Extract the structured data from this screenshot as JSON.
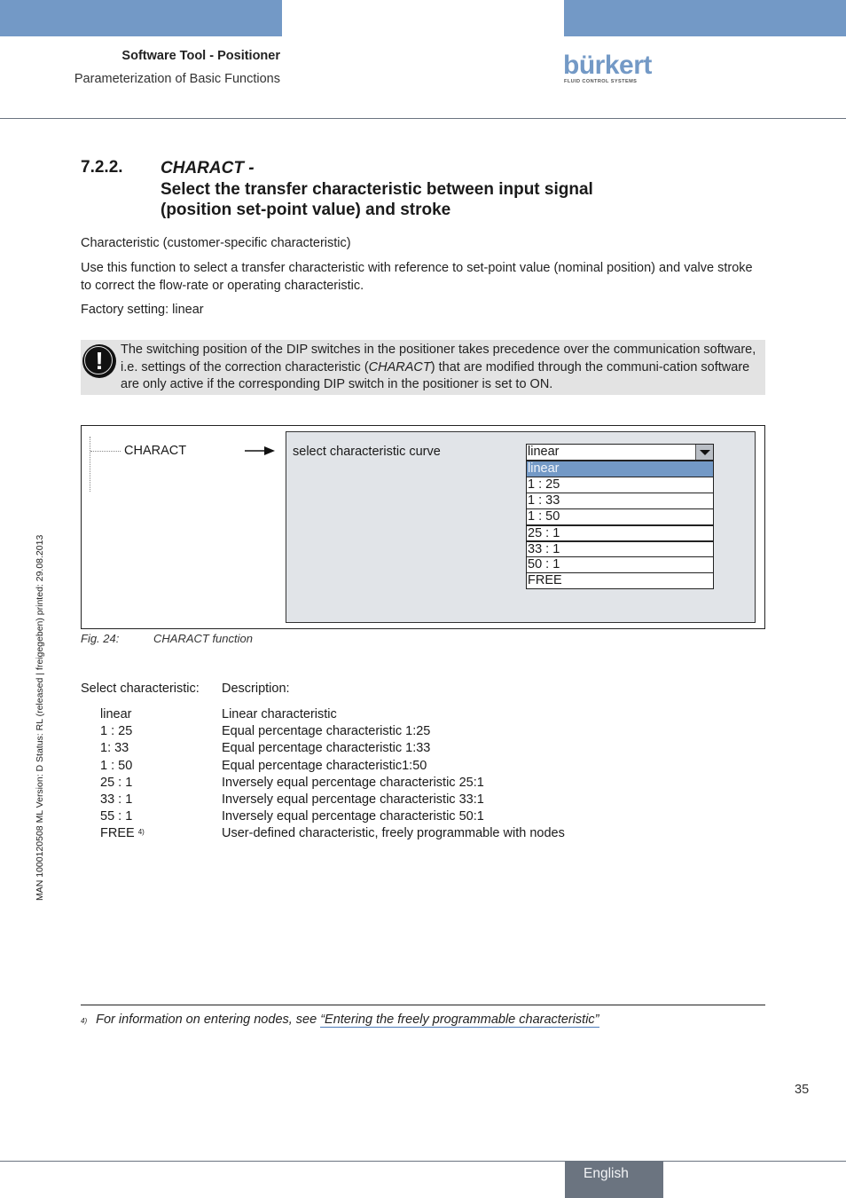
{
  "header": {
    "title": "Software Tool - Positioner",
    "subtitle": "Parameterization of Basic Functions",
    "logo": {
      "word": "bürkert",
      "tagline": "FLUID CONTROL SYSTEMS"
    },
    "accent_color": "#7399c6"
  },
  "section": {
    "number": "7.2.2.",
    "title_italic": "CHARACT -",
    "title_line2": "Select the transfer characteristic between input signal",
    "title_line3": "(position set-point value) and stroke"
  },
  "paragraphs": [
    "Characteristic (customer-specific characteristic)",
    "Use this function to select a transfer characteristic with reference to set-point value (nominal position) and valve stroke to correct the flow-rate or operating characteristic.",
    "Factory setting: linear"
  ],
  "note": {
    "icon": "exclamation-icon",
    "text_before": "The switching position of the DIP switches in the positioner takes precedence over the communication software, i.e. settings of the correction characteristic (",
    "text_italic": "CHARACT",
    "text_after": ") that are modified through the communi-cation software are only active if the corresponding DIP switch in the positioner is set to ON."
  },
  "figure": {
    "tree_item": "CHARACT",
    "panel_label": "select characteristic curve",
    "dropdown": {
      "selected": "linear",
      "options": [
        "linear",
        "1 : 25",
        "1 : 33",
        "1 : 50",
        "25 : 1",
        "33 : 1",
        "50 : 1",
        "FREE"
      ],
      "highlighted": "linear",
      "highlight_color": "#7399c6"
    },
    "caption_label": "Fig. 24:",
    "caption_text": "CHARACT function"
  },
  "table": {
    "col1_header": "Select characteristic:",
    "col2_header": "Description:",
    "rows": [
      {
        "key": "linear",
        "desc": "Linear characteristic"
      },
      {
        "key": "1 : 25",
        "desc": "Equal percentage characteristic 1:25"
      },
      {
        "key": "1: 33",
        "desc": "Equal percentage characteristic 1:33"
      },
      {
        "key": "1 : 50",
        "desc": "Equal percentage characteristic1:50"
      },
      {
        "key": "25 : 1",
        "desc": "Inversely equal percentage characteristic 25:1"
      },
      {
        "key": "33 : 1",
        "desc": "Inversely equal percentage characteristic 33:1"
      },
      {
        "key": "55 : 1",
        "desc": "Inversely equal percentage characteristic 50:1"
      },
      {
        "key": "FREE",
        "sup": "4)",
        "desc": "User-defined characteristic, freely programmable with nodes"
      }
    ]
  },
  "side_text": "MAN  1000120508  ML  Version: D  Status: RL (released | freigegeben)  printed: 29.08.2013",
  "footnote": {
    "mark": "4)",
    "text": "For information on entering nodes, see ",
    "link": "“Entering the freely programmable characteristic”"
  },
  "footer": {
    "page_number": "35",
    "language": "English"
  }
}
